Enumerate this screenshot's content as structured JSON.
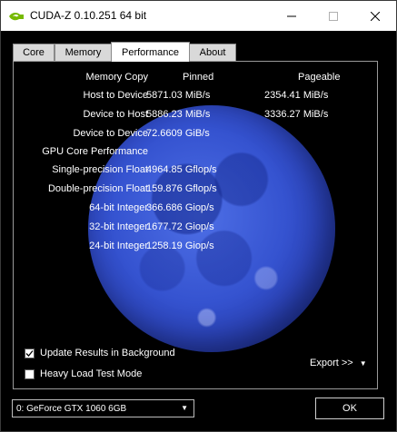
{
  "window": {
    "title": "CUDA-Z 0.10.251 64 bit"
  },
  "tabs": [
    {
      "label": "Core"
    },
    {
      "label": "Memory"
    },
    {
      "label": "Performance"
    },
    {
      "label": "About"
    }
  ],
  "active_tab": "Performance",
  "performance": {
    "columns": {
      "label": "Memory Copy",
      "pinned": "Pinned",
      "pageable": "Pageable"
    },
    "rows": [
      {
        "label": "Host to Device",
        "pinned": "5871.03 MiB/s",
        "pageable": "2354.41 MiB/s"
      },
      {
        "label": "Device to Host",
        "pinned": "5886.23 MiB/s",
        "pageable": "3336.27 MiB/s"
      },
      {
        "label": "Device to Device",
        "pinned": "72.6609 GiB/s",
        "pageable": ""
      },
      {
        "label": "GPU Core Performance",
        "pinned": "",
        "pageable": ""
      },
      {
        "label": "Single-precision Float",
        "pinned": "4964.85 Gflop/s",
        "pageable": ""
      },
      {
        "label": "Double-precision Float",
        "pinned": "159.876 Gflop/s",
        "pageable": ""
      },
      {
        "label": "64-bit Integer",
        "pinned": "366.686 Giop/s",
        "pageable": ""
      },
      {
        "label": "32-bit Integer",
        "pinned": "1677.72 Giop/s",
        "pageable": ""
      },
      {
        "label": "24-bit Integer",
        "pinned": "1258.19 Giop/s",
        "pageable": ""
      }
    ]
  },
  "options": {
    "update_background": {
      "label": "Update Results in Background",
      "checked": true
    },
    "heavy_load": {
      "label": "Heavy Load Test Mode",
      "checked": false
    }
  },
  "export": {
    "label": "Export >>"
  },
  "gpu_select": {
    "value": "0: GeForce GTX 1060 6GB"
  },
  "ok_button": {
    "label": "OK"
  },
  "colors": {
    "background": "#000000",
    "moon": "#3553d0",
    "text": "#ffffff"
  }
}
